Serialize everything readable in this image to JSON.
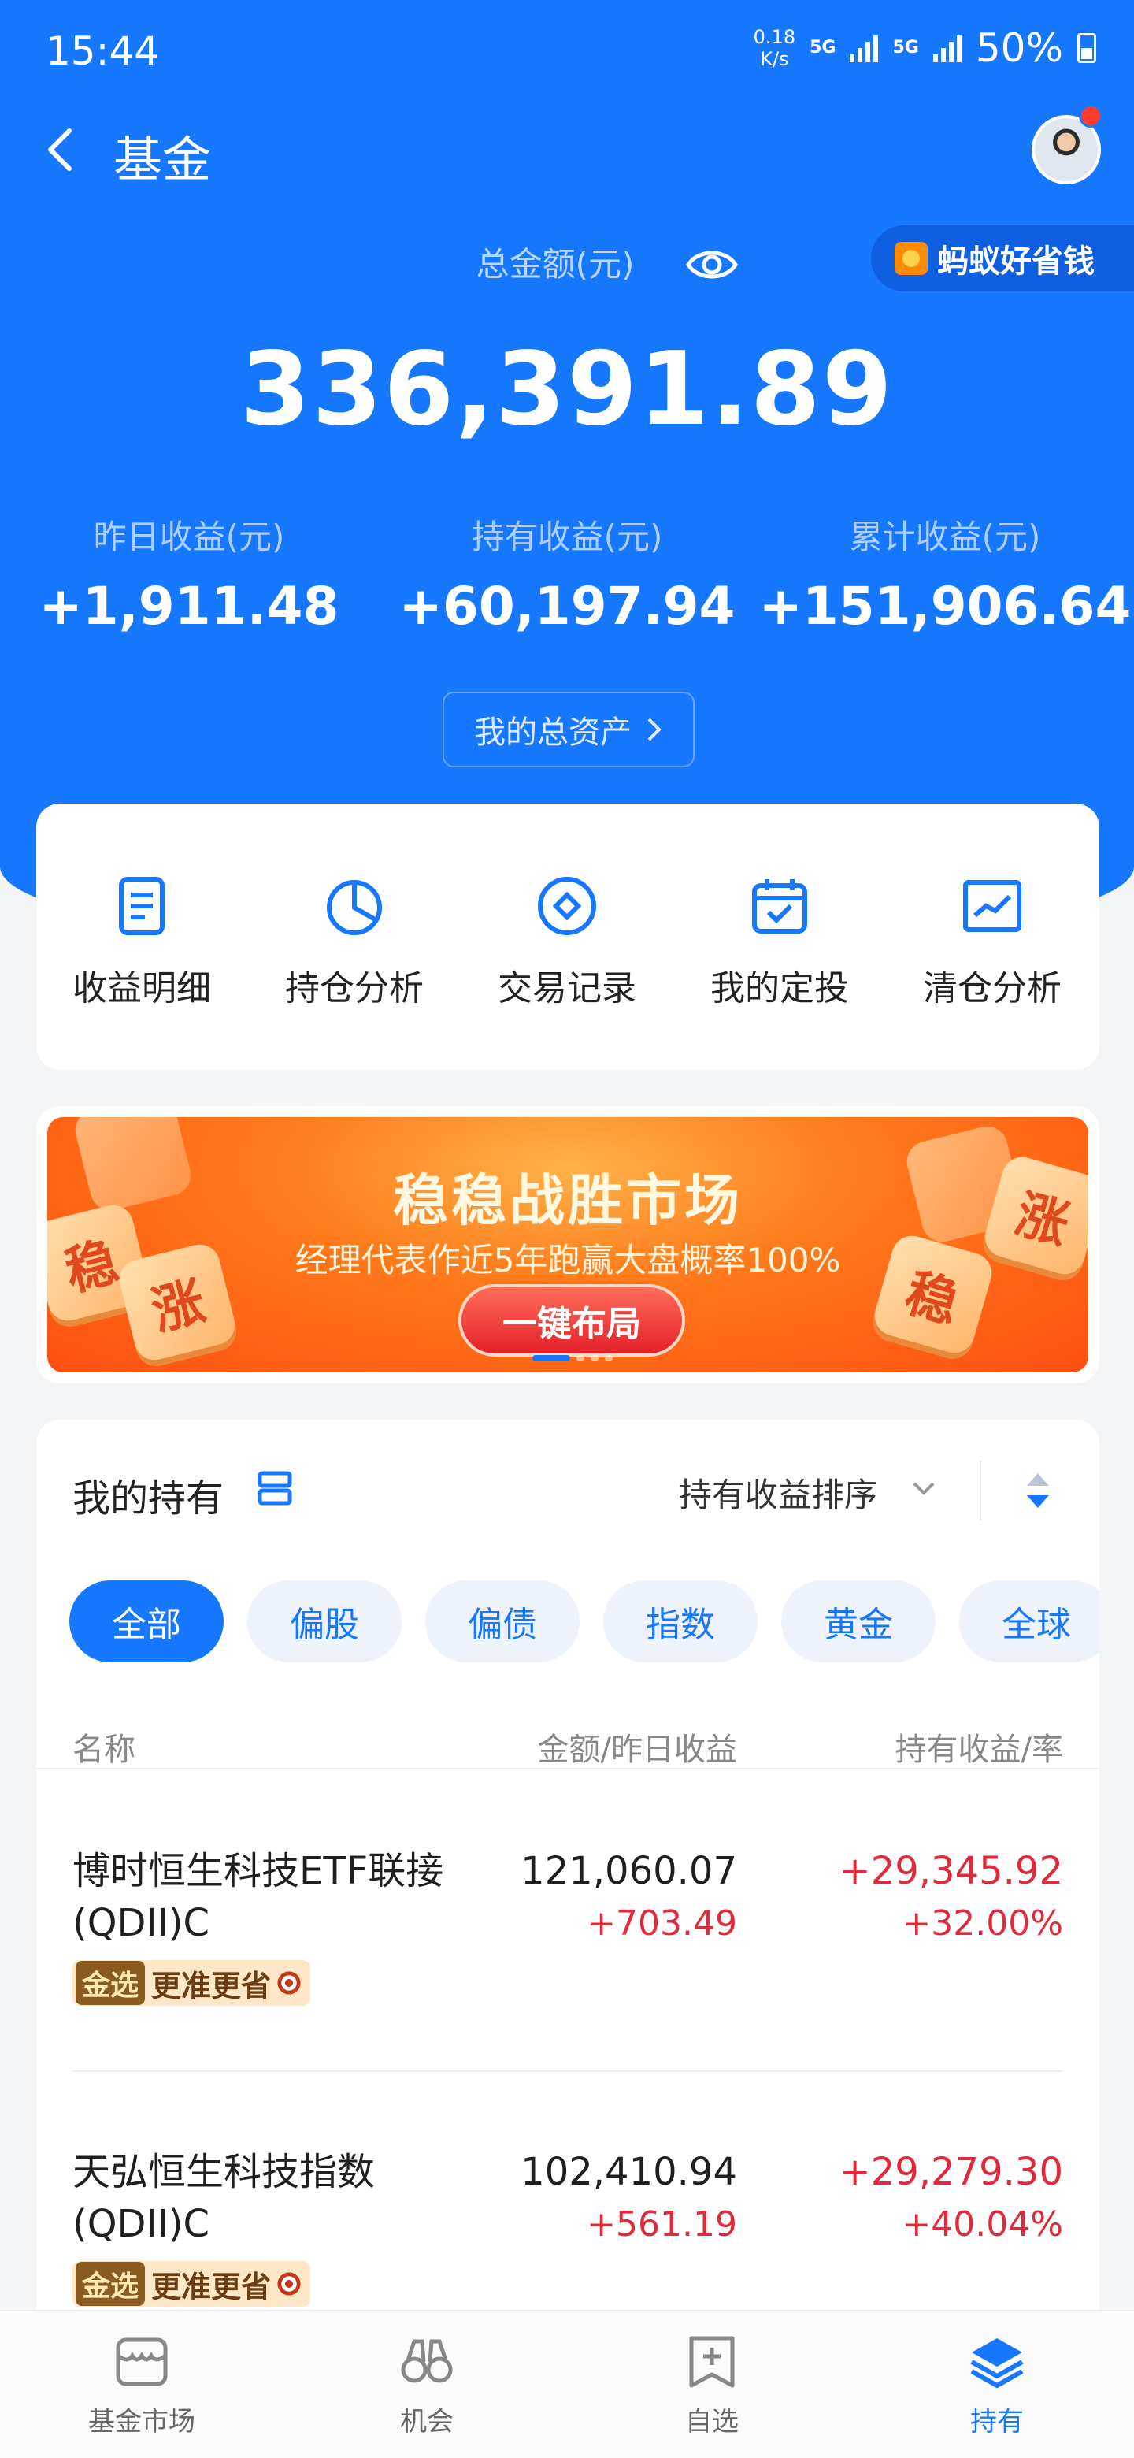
{
  "status_bar": {
    "time": "15:44",
    "speed_value": "0.18",
    "speed_unit": "K/s",
    "net1": "5G",
    "net2": "5G",
    "battery": "50%"
  },
  "nav": {
    "title": "基金"
  },
  "promo": {
    "label": "蚂蚁好省钱"
  },
  "summary": {
    "total_label": "总金额(元)",
    "total_amount": "336,391.89",
    "stats": [
      {
        "label": "昨日收益(元)",
        "value": "+1,911.48"
      },
      {
        "label": "持有收益(元)",
        "value": "+60,197.94"
      },
      {
        "label": "累计收益(元)",
        "value": "+151,906.64"
      }
    ],
    "assets_button": "我的总资产"
  },
  "shortcuts": [
    {
      "label": "收益明细",
      "icon": "document-icon"
    },
    {
      "label": "持仓分析",
      "icon": "pie-chart-icon"
    },
    {
      "label": "交易记录",
      "icon": "diamond-circle-icon"
    },
    {
      "label": "我的定投",
      "icon": "calendar-check-icon"
    },
    {
      "label": "清仓分析",
      "icon": "trend-chart-icon"
    }
  ],
  "banner": {
    "title": "稳稳战胜市场",
    "subtitle": "经理代表作近5年跑赢大盘概率100%",
    "cta": "一键布局",
    "tiles": [
      "稳",
      "涨",
      "稳",
      "涨"
    ]
  },
  "holdings": {
    "title": "我的持有",
    "sort_label": "持有收益排序",
    "chips": [
      "全部",
      "偏股",
      "偏债",
      "指数",
      "黄金",
      "全球"
    ],
    "columns": {
      "name": "名称",
      "amount": "金额/昨日收益",
      "hold": "持有收益/率"
    },
    "rows": [
      {
        "name": "博时恒生科技ETF联接(QDII)C",
        "tag_key": "金选",
        "tag_text": "更准更省",
        "amount": "121,060.07",
        "yesterday": "+703.49",
        "hold": "+29,345.92",
        "rate": "+32.00%"
      },
      {
        "name": "天弘恒生科技指数(QDII)C",
        "tag_key": "金选",
        "tag_text": "更准更省",
        "amount": "102,410.94",
        "yesterday": "+561.19",
        "hold": "+29,279.30",
        "rate": "+40.04%"
      }
    ]
  },
  "tabbar": [
    {
      "label": "基金市场",
      "icon": "market-icon"
    },
    {
      "label": "机会",
      "icon": "binoculars-icon"
    },
    {
      "label": "自选",
      "icon": "bookmark-add-icon"
    },
    {
      "label": "持有",
      "icon": "layers-icon"
    }
  ],
  "colors": {
    "brand": "#1677ff",
    "gain": "#e0293b"
  }
}
